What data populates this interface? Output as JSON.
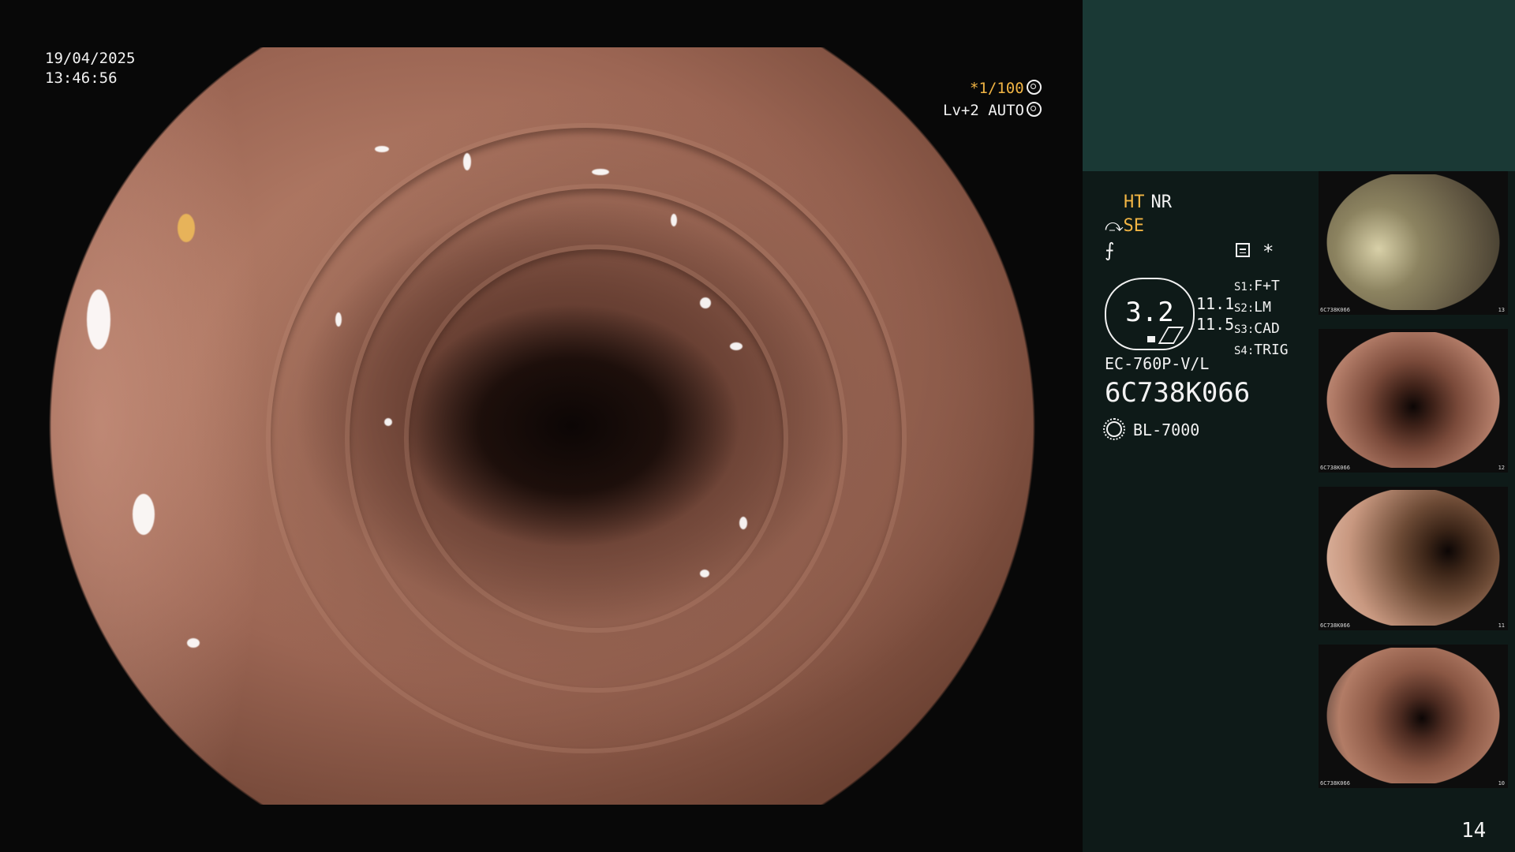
{
  "endoscope_view": {
    "date": "19/04/2025",
    "time": "13:46:56",
    "shutter": "*1/100",
    "level": "Lv+2 AUTO"
  },
  "panel": {
    "ht": "HT",
    "nr": "NR",
    "se": "SE",
    "star": "*",
    "octagon_value": "3.2",
    "value_1": "11.1",
    "value_2": "11.5",
    "switches": [
      {
        "label": "S1:",
        "value": "F+T"
      },
      {
        "label": "S2:",
        "value": "LM"
      },
      {
        "label": "S3:",
        "value": "CAD"
      },
      {
        "label": "S4:",
        "value": "TRIG"
      }
    ],
    "scope_model": "EC-760P-V/L",
    "scope_serial": "6C738K066",
    "light_source": "BL-7000",
    "page_number": "14"
  },
  "thumbnails": [
    {
      "label": "6C738K066",
      "number": "13"
    },
    {
      "label": "6C738K066",
      "number": "12"
    },
    {
      "label": "6C738K066",
      "number": "11"
    },
    {
      "label": "6C738K066",
      "number": "10"
    }
  ],
  "colors": {
    "accent": "#f2b544",
    "panel_bg": "#0e1a18",
    "panel_top": "#1a3935"
  }
}
